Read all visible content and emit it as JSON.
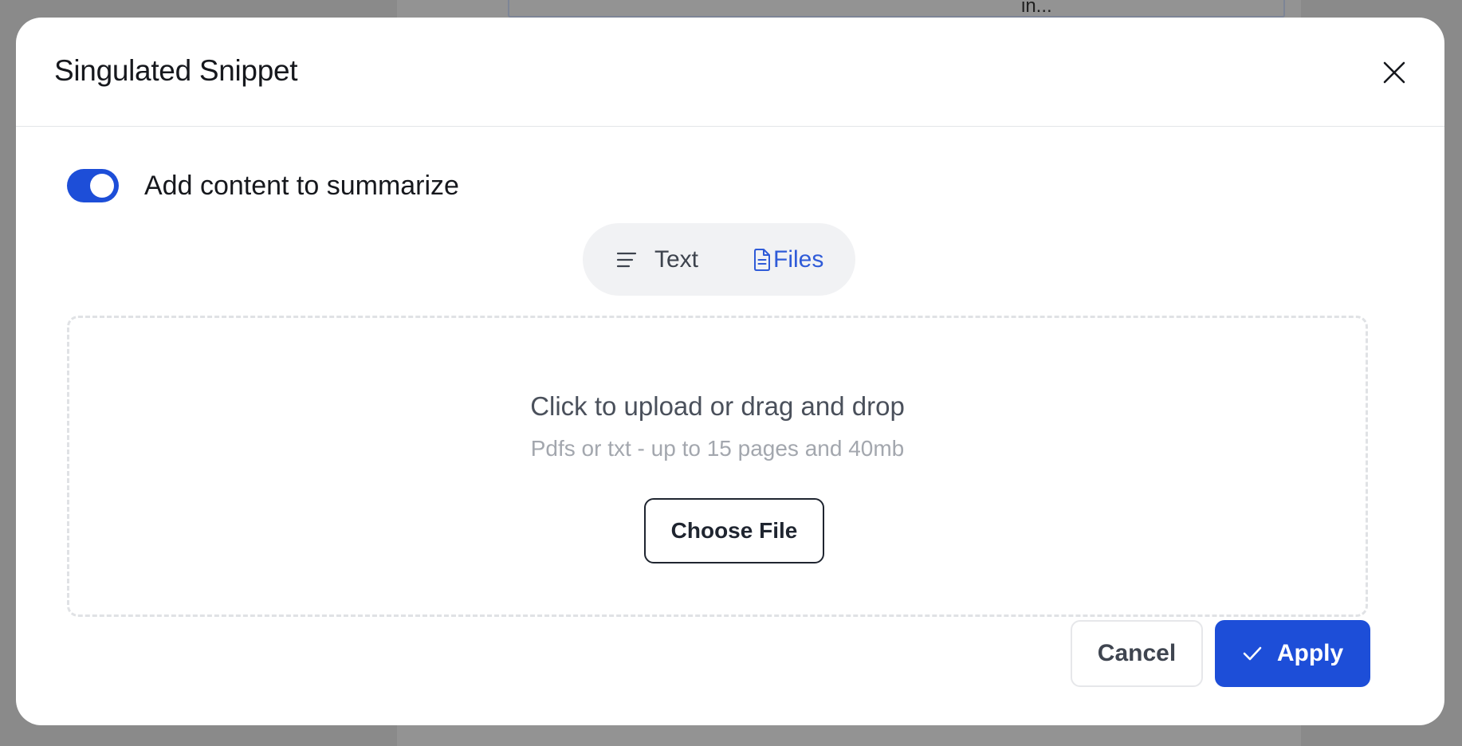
{
  "backdrop": {
    "snippet_text": "in..."
  },
  "modal": {
    "title": "Singulated Snippet"
  },
  "toggle": {
    "label": "Add content to summarize",
    "enabled": true
  },
  "segmented": {
    "text_label": "Text",
    "files_label": "Files",
    "active": "Files"
  },
  "dropzone": {
    "title": "Click to upload or drag and drop",
    "subtitle": "Pdfs or txt - up to 15 pages and 40mb",
    "choose_label": "Choose File"
  },
  "footer": {
    "cancel_label": "Cancel",
    "apply_label": "Apply"
  },
  "colors": {
    "accent": "#1d4ed8",
    "active_tab": "#2f5bd8",
    "overlay": "#8a8a8a"
  },
  "icons": {
    "close": "close-icon",
    "text": "lines-icon",
    "files": "file-icon",
    "apply": "check-icon"
  }
}
